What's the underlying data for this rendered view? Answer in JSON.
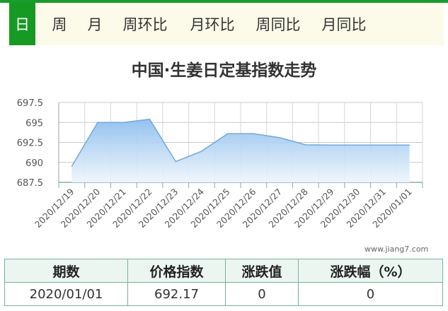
{
  "tabs": [
    {
      "label": "日",
      "active": true
    },
    {
      "label": "周",
      "active": false
    },
    {
      "label": "月",
      "active": false
    },
    {
      "label": "周环比",
      "active": false
    },
    {
      "label": "月环比",
      "active": false
    },
    {
      "label": "周同比",
      "active": false
    },
    {
      "label": "月同比",
      "active": false
    }
  ],
  "watermark": "www.jiang7.com",
  "table": {
    "headers": [
      "期数",
      "价格指数",
      "涨跌值",
      "涨跌幅（%）"
    ],
    "row": [
      "2020/01/01",
      "692.17",
      "0",
      "0"
    ]
  },
  "colors": {
    "accent": "#169a24",
    "line": "#6fa8dc",
    "fill_top": "#8fbfee",
    "fill_bottom": "#eef5fc"
  },
  "chart_data": {
    "type": "area",
    "title": "中国·生姜日定基指数走势",
    "xlabel": "",
    "ylabel": "",
    "categories": [
      "2020/12/19",
      "2020/12/20",
      "2020/12/21",
      "2020/12/22",
      "2020/12/23",
      "2020/12/24",
      "2020/12/25",
      "2020/12/26",
      "2020/12/27",
      "2020/12/28",
      "2020/12/29",
      "2020/12/30",
      "2020/12/31",
      "2020/01/01"
    ],
    "series": [
      {
        "values": [
          689.5,
          695.0,
          695.0,
          695.4,
          690.1,
          691.4,
          693.6,
          693.6,
          693.1,
          692.2,
          692.17,
          692.17,
          692.17,
          692.17
        ]
      }
    ],
    "ylim": [
      687.5,
      697.5
    ],
    "yticks": [
      "687.5",
      "690",
      "692.5",
      "695",
      "697.5"
    ],
    "grid": true
  }
}
